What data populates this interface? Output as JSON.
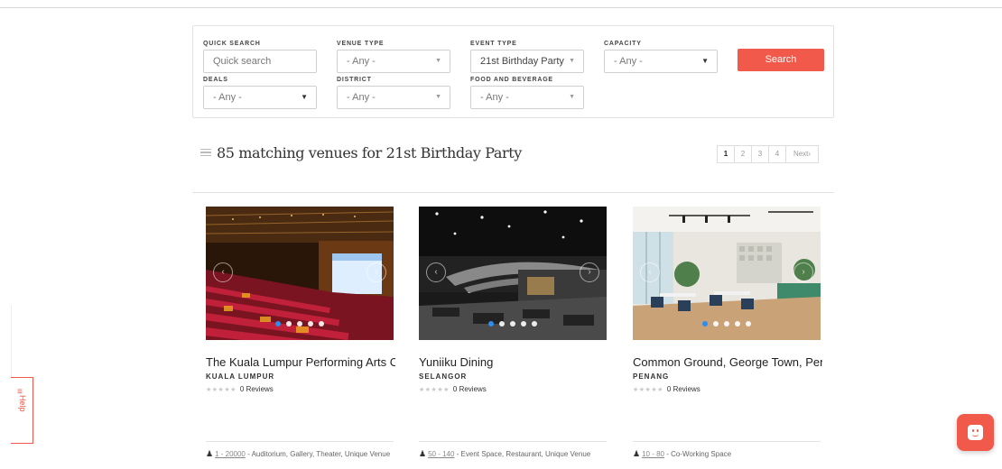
{
  "search": {
    "quick_search": {
      "label": "QUICK SEARCH",
      "placeholder": "Quick search"
    },
    "venue_type": {
      "label": "VENUE TYPE",
      "value": "- Any -"
    },
    "event_type": {
      "label": "EVENT TYPE",
      "value": "21st Birthday Party"
    },
    "capacity": {
      "label": "CAPACITY",
      "value": "- Any -"
    },
    "deals": {
      "label": "DEALS",
      "value": "- Any -"
    },
    "district": {
      "label": "DISTRICT",
      "value": "- Any -"
    },
    "food_beverage": {
      "label": "FOOD AND BEVERAGE",
      "value": "- Any -"
    },
    "search_button": "Search"
  },
  "results": {
    "title": "85 matching venues for 21st Birthday Party"
  },
  "pagination": {
    "pages": [
      "1",
      "2",
      "3",
      "4"
    ],
    "current": "1",
    "next_label": "Next›"
  },
  "venues": [
    {
      "name": "The Kuala Lumpur Performing Arts C",
      "region": "KUALA LUMPUR",
      "reviews": "0 Reviews",
      "capacity": "1 - 20000",
      "types": "- Auditorium, Gallery, Theater, Unique Venue"
    },
    {
      "name": "Yuniiku Dining",
      "region": "SELANGOR",
      "reviews": "0 Reviews",
      "capacity": "50 - 140",
      "types": "- Event Space, Restaurant, Unique Venue"
    },
    {
      "name": "Common Ground, George Town, Pen",
      "region": "PENANG",
      "reviews": "0 Reviews",
      "capacity": "10 - 80",
      "types": "- Co-Working Space"
    }
  ],
  "help_tab": {
    "label": "Help"
  },
  "colors": {
    "accent": "#f1594a",
    "active_dot": "#2b8ef0"
  }
}
